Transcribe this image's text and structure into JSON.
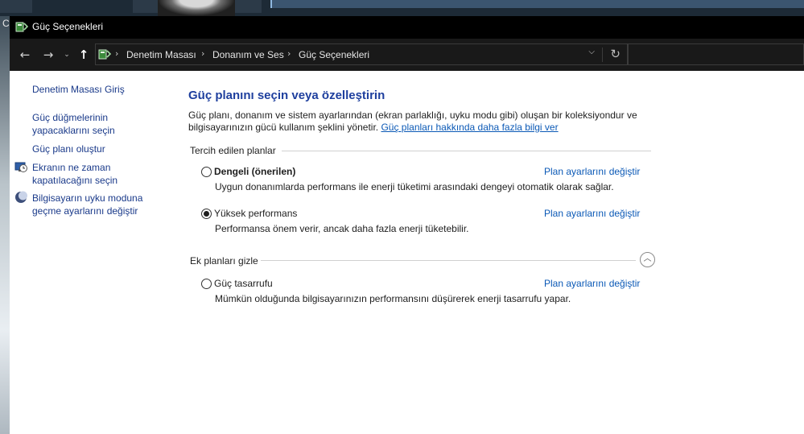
{
  "window": {
    "title": "Güç Seçenekleri",
    "corner_tag": "C"
  },
  "address_bar": {
    "breadcrumbs": [
      "Denetim Masası",
      "Donanım ve Ses",
      "Güç Seçenekleri"
    ],
    "icons": [
      "back-arrow-icon",
      "forward-arrow-icon",
      "recent-dropdown-icon",
      "up-arrow-icon",
      "power-options-icon",
      "chevron-right-icon",
      "chevron-down-icon",
      "refresh-icon"
    ]
  },
  "sidebar": {
    "home": "Denetim Masası Giriş",
    "items": [
      {
        "label_1": "Güç düğmelerinin",
        "label_2": "yapacaklarını seçin"
      },
      {
        "label_1": "Güç planı oluştur"
      },
      {
        "label_1": "Ekranın ne zaman",
        "label_2": "kapatılacağını seçin",
        "icon": "clock-monitor-icon"
      },
      {
        "label_1": "Bilgisayarın uyku moduna",
        "label_2": "geçme ayarlarını değiştir",
        "icon": "moon-icon"
      }
    ]
  },
  "main": {
    "heading": "Güç planını seçin veya özelleştirin",
    "description_line1": "Güç planı, donanım ve sistem ayarlarından (ekran parlaklığı, uyku modu gibi) oluşan bir koleksiyondur ve",
    "description_line2": "bilgisayarınızın gücü kullanım şeklini yönetir.",
    "description_link": "Güç planları hakkında daha fazla bilgi ver",
    "preferred_group_label": "Tercih edilen planlar",
    "extra_group_label": "Ek planları gizle",
    "change_link": "Plan ayarlarını değiştir",
    "plans": [
      {
        "name": "Dengeli (önerilen)",
        "description": "Uygun donanımlarda performans ile enerji tüketimi arasındaki dengeyi otomatik olarak sağlar.",
        "selected": false
      },
      {
        "name": "Yüksek performans",
        "description": "Performansa önem verir, ancak daha fazla enerji tüketebilir.",
        "selected": true
      },
      {
        "name": "Güç tasarrufu",
        "description": "Mümkün olduğunda bilgisayarınızın performansını düşürerek enerji tasarrufu yapar.",
        "selected": false
      }
    ]
  },
  "colors": {
    "accent_heading": "#1e3f9e",
    "link": "#0b59b6",
    "titlebar": "#000000"
  }
}
